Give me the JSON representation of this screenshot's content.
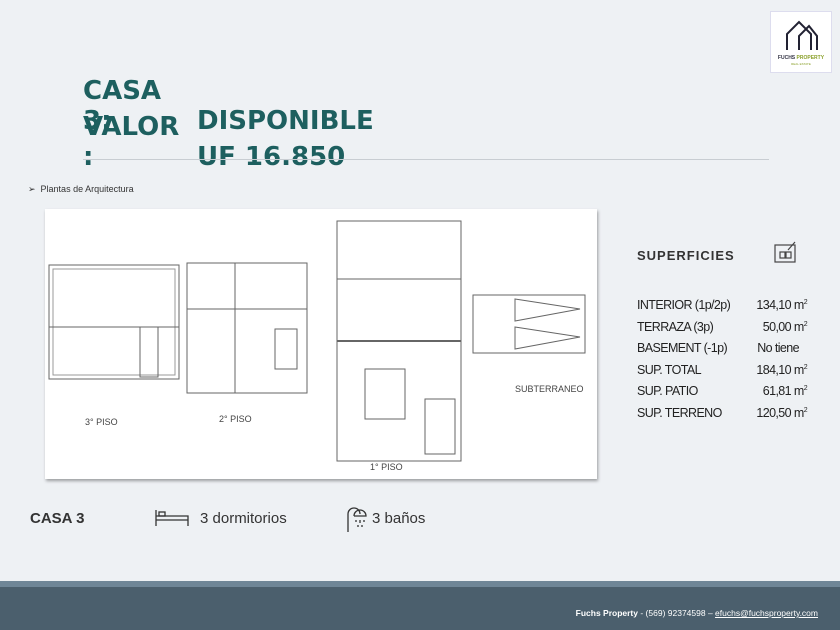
{
  "header": {
    "line1_label": "CASA 3:",
    "line1_value": "DISPONIBLE",
    "line2_label": "VALOR :",
    "line2_value": "UF 16.850"
  },
  "logo": {
    "text": "FUCHS PROPERTY",
    "sub": "REAL ESTATE"
  },
  "section_bullet": "Plantas de Arquitectura",
  "plan_labels": {
    "piso3": "3° PISO",
    "piso2": "2° PISO",
    "piso1": "1° PISO",
    "sub": "SUBTERRANEO"
  },
  "superficies": {
    "title": "SUPERFICIES",
    "rows": [
      {
        "label": "INTERIOR (1p/2p)",
        "value": "134,10 m",
        "unit_sup": "2"
      },
      {
        "label": "TERRAZA (3p)",
        "value": "50,00 m",
        "unit_sup": "2"
      },
      {
        "label": "BASEMENT (-1p)",
        "value": "No tiene",
        "unit_sup": ""
      },
      {
        "label": "SUP. TOTAL",
        "value": "184,10 m",
        "unit_sup": "2"
      },
      {
        "label": "SUP. PATIO",
        "value": "61,81 m",
        "unit_sup": "2"
      },
      {
        "label": "SUP. TERRENO",
        "value": "120,50 m",
        "unit_sup": "2"
      }
    ]
  },
  "features": {
    "casa": "CASA 3",
    "dormitorios": "3 dormitorios",
    "banos": "3 baños"
  },
  "footer": {
    "company": "Fuchs Property",
    "phone": " - (569) 92374598 – ",
    "email": "efuchs@fuchsproperty.com"
  }
}
